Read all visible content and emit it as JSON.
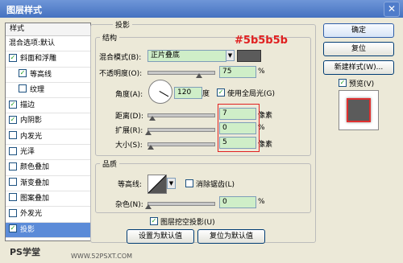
{
  "window": {
    "title": "图层样式",
    "close": "✕"
  },
  "sidebar": {
    "header": "样式",
    "items": [
      {
        "label": "混合选项:默认",
        "check": ""
      },
      {
        "label": "斜面和浮雕",
        "check": "✓"
      },
      {
        "label": "等高线",
        "check": "✓"
      },
      {
        "label": "纹理",
        "check": ""
      },
      {
        "label": "描边",
        "check": "✓"
      },
      {
        "label": "内阴影",
        "check": "✓"
      },
      {
        "label": "内发光",
        "check": ""
      },
      {
        "label": "光泽",
        "check": ""
      },
      {
        "label": "颜色叠加",
        "check": ""
      },
      {
        "label": "渐变叠加",
        "check": ""
      },
      {
        "label": "图案叠加",
        "check": ""
      },
      {
        "label": "外发光",
        "check": ""
      },
      {
        "label": "投影",
        "check": "✓"
      }
    ]
  },
  "main": {
    "section_title": "投影",
    "structure": {
      "title": "结构",
      "blend_mode_label": "混合模式(B):",
      "blend_mode_value": "正片叠底",
      "opacity_label": "不透明度(O):",
      "opacity_value": "75",
      "percent": "%",
      "angle_label": "角度(A):",
      "angle_value": "120",
      "degree": "度",
      "global_light": "使用全局光(G)",
      "global_light_check": "✓",
      "distance_label": "距离(D):",
      "distance_value": "7",
      "pixels": "像素",
      "spread_label": "扩展(R):",
      "spread_value": "0",
      "size_label": "大小(S):",
      "size_value": "5",
      "color_annotation": "#5b5b5b",
      "shadow_color": "#5b5b5b"
    },
    "quality": {
      "title": "品质",
      "contour_label": "等高线:",
      "antialias": "消除锯齿(L)",
      "noise_label": "杂色(N):",
      "noise_value": "0"
    },
    "knockout": "图层挖空投影(U)",
    "knockout_check": "✓",
    "set_default": "设置为默认值",
    "reset_default": "复位为默认值"
  },
  "buttons": {
    "ok": "确定",
    "reset": "复位",
    "new_style": "新建样式(W)...",
    "preview": "预览(V)",
    "preview_check": "✓"
  },
  "footer": {
    "logo": "PS学堂",
    "watermark": "WWW.52PSXT.COM"
  }
}
